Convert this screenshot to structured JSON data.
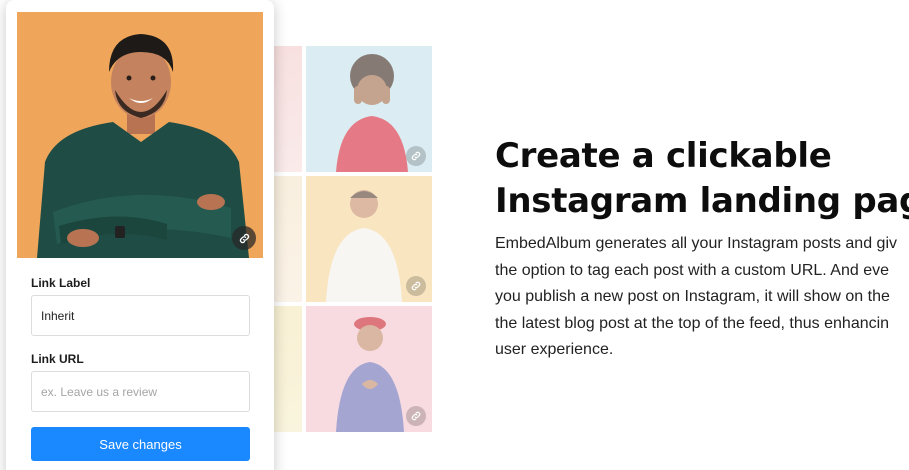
{
  "card": {
    "link_label": {
      "label": "Link Label",
      "value": "Inherit"
    },
    "link_url": {
      "label": "Link URL",
      "placeholder": "ex. Leave us a review"
    },
    "save_label": "Save changes"
  },
  "hero": {
    "headline_lines": [
      "Create a clickable",
      "Instagram landing page"
    ],
    "body_lines": [
      "EmbedAlbum generates all your Instagram posts and giv",
      "the option to tag each post with a custom URL. And eve",
      "you publish a new post on Instagram, it will show on the",
      "the latest blog post at the top of the feed, thus enhancin",
      "user experience."
    ]
  },
  "colors": {
    "accent": "#1a88ff",
    "photo_background": "#efa55a"
  },
  "icons": [
    "link-icon"
  ]
}
